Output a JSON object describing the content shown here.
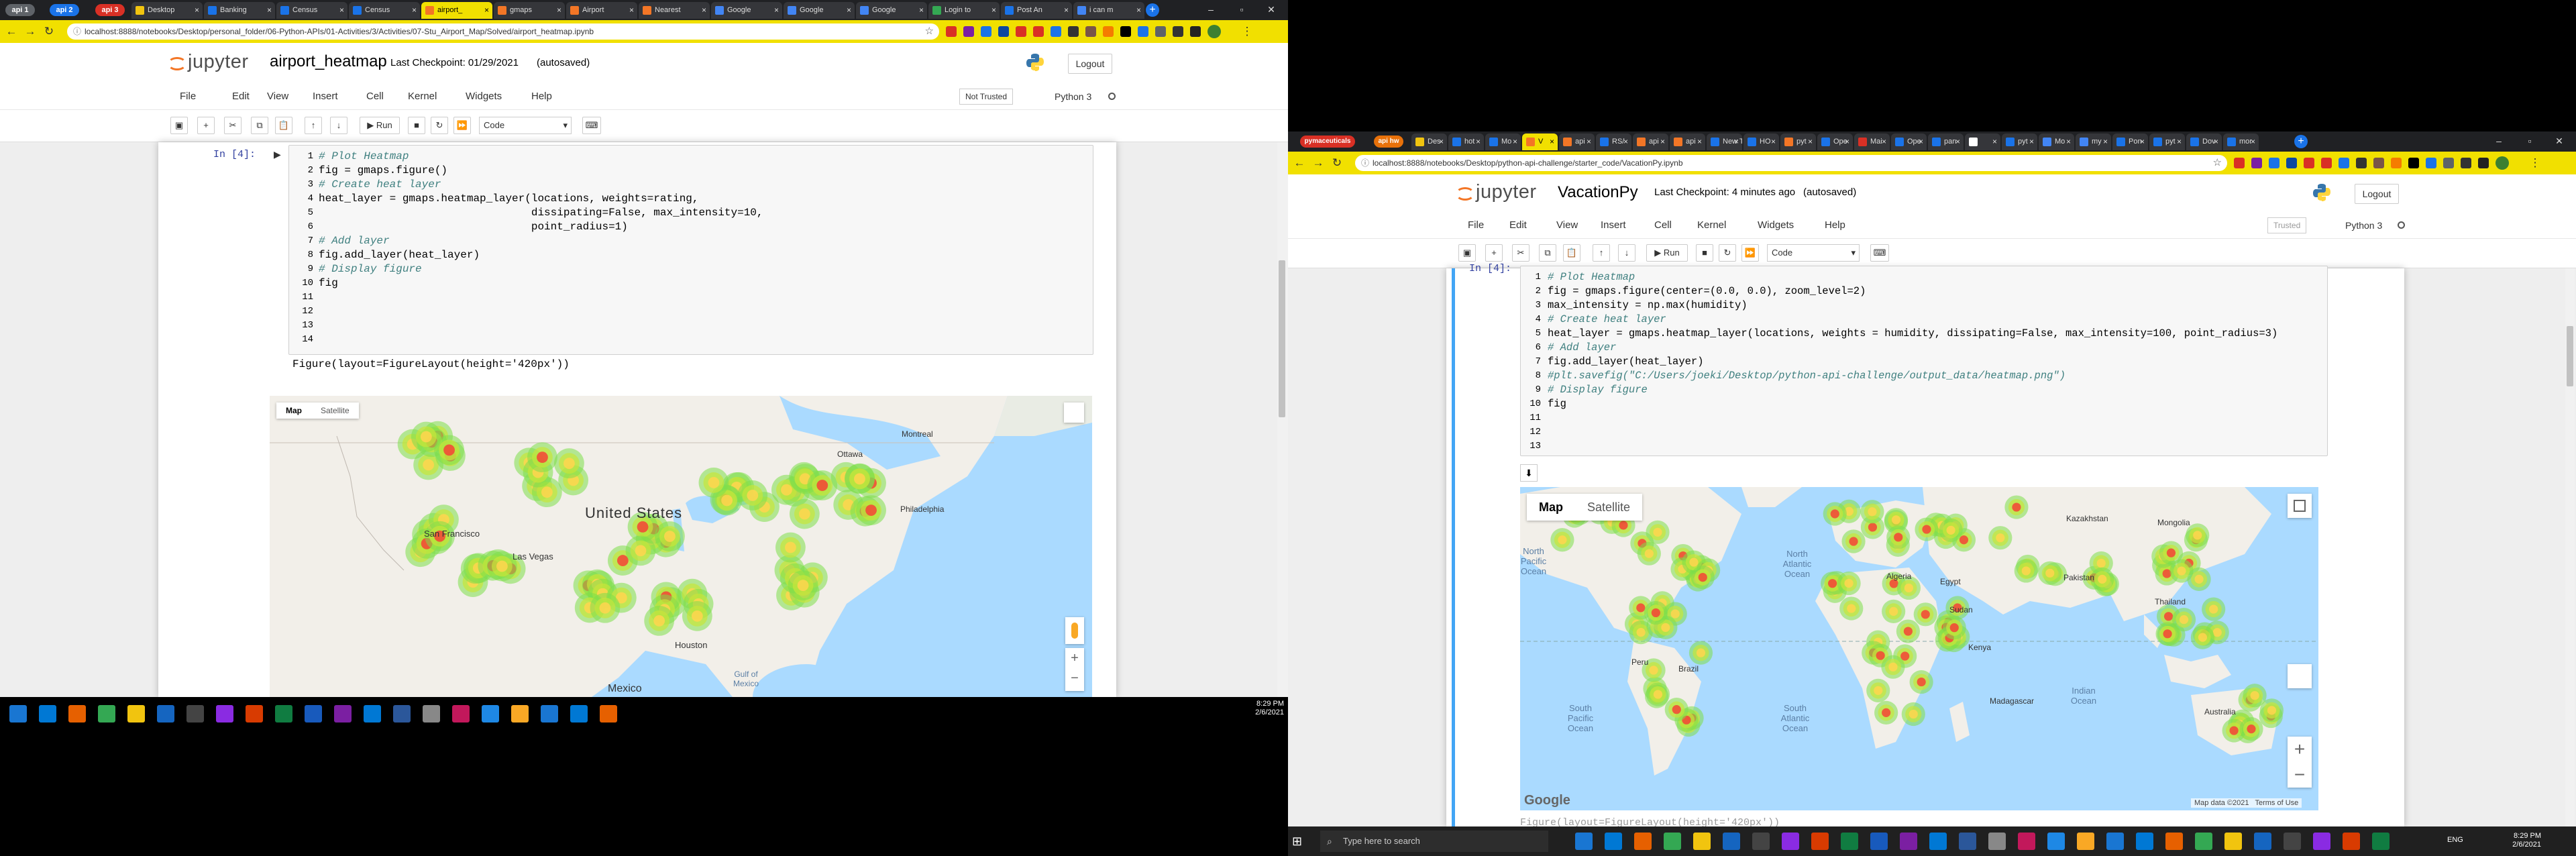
{
  "left_window": {
    "tab_groups": [
      {
        "label": "api 1",
        "color": "#5f6368"
      },
      {
        "label": "api 2",
        "color": "#1a73e8"
      },
      {
        "label": "api 3",
        "color": "#d93025"
      }
    ],
    "tabs": [
      {
        "title": "Desktop",
        "favicon_color": "#f1c40f"
      },
      {
        "title": "Banking",
        "favicon_color": "#1a73e8"
      },
      {
        "title": "Census",
        "favicon_color": "#1a73e8"
      },
      {
        "title": "Census",
        "favicon_color": "#1a73e8"
      },
      {
        "title": "airport_",
        "favicon_color": "#f37626",
        "active": true
      },
      {
        "title": "gmaps",
        "favicon_color": "#f37626"
      },
      {
        "title": "Airport",
        "favicon_color": "#f37626"
      },
      {
        "title": "Nearest",
        "favicon_color": "#f37626"
      },
      {
        "title": "Google",
        "favicon_color": "#4285f4"
      },
      {
        "title": "Google",
        "favicon_color": "#4285f4"
      },
      {
        "title": "Google",
        "favicon_color": "#4285f4"
      },
      {
        "title": "Login to",
        "favicon_color": "#34a853"
      },
      {
        "title": "Post An",
        "favicon_color": "#1a73e8"
      },
      {
        "title": "i can m",
        "favicon_color": "#4285f4"
      }
    ],
    "url": "localhost:8888/notebooks/Desktop/personal_folder/06-Python-APIs/01-Activities/3/Activities/07-Stu_Airport_Map/Solved/airport_heatmap.ipynb",
    "notebook_name": "airport_heatmap",
    "checkpoint": "Last Checkpoint: 01/29/2021",
    "autosave": "(autosaved)",
    "logout": "Logout",
    "menu": [
      "File",
      "Edit",
      "View",
      "Insert",
      "Cell",
      "Kernel",
      "Widgets",
      "Help"
    ],
    "trust": "Not Trusted",
    "kernel": "Python 3",
    "run_label": "Run",
    "cell_type": "Code",
    "cell_prompt": "In [4]:",
    "code_lines": [
      "# Plot Heatmap",
      "fig = gmaps.figure()",
      "",
      "# Create heat layer",
      "heat_layer = gmaps.heatmap_layer(locations, weights=rating,",
      "                                 dissipating=False, max_intensity=10,",
      "                                 point_radius=1)",
      "",
      "",
      "# Add layer",
      "fig.add_layer(heat_layer)",
      "",
      "# Display figure",
      "fig"
    ],
    "output_text": "Figure(layout=FigureLayout(height='420px'))",
    "map": {
      "type_map": "Map",
      "type_satellite": "Satellite",
      "labels": [
        "United States",
        "Ottawa",
        "Montreal",
        "Philadelphia",
        "San Francisco",
        "Las Vegas",
        "Houston",
        "Mexico",
        "Gulf of Mexico"
      ]
    }
  },
  "right_window": {
    "tab_groups": [
      {
        "label": "pymaceuticals",
        "color": "#d93025"
      },
      {
        "label": "api hw",
        "color": "#e8710a"
      }
    ],
    "tabs": [
      {
        "title": "Des",
        "favicon_color": "#f1c40f"
      },
      {
        "title": "hot",
        "favicon_color": "#1a73e8"
      },
      {
        "title": "Mo",
        "favicon_color": "#1a73e8"
      },
      {
        "title": "V",
        "favicon_color": "#f37626",
        "active": true
      },
      {
        "title": "api",
        "favicon_color": "#f37626"
      },
      {
        "title": "RS/",
        "favicon_color": "#1a73e8"
      },
      {
        "title": "api",
        "favicon_color": "#f37626"
      },
      {
        "title": "api",
        "favicon_color": "#f37626"
      },
      {
        "title": "New Tab",
        "favicon_color": "#1a73e8"
      },
      {
        "title": "HO",
        "favicon_color": "#1a73e8"
      },
      {
        "title": "pyt",
        "favicon_color": "#f37626"
      },
      {
        "title": "Ope",
        "favicon_color": "#1a73e8"
      },
      {
        "title": "Mai",
        "favicon_color": "#d93025"
      },
      {
        "title": "Ope",
        "favicon_color": "#1a73e8"
      },
      {
        "title": "pan",
        "favicon_color": "#1a73e8"
      },
      {
        "title": "",
        "favicon_color": "#ffffff"
      },
      {
        "title": "pyt",
        "favicon_color": "#1a73e8"
      },
      {
        "title": "Mo",
        "favicon_color": "#4285f4"
      },
      {
        "title": "my",
        "favicon_color": "#4285f4"
      },
      {
        "title": "Pon",
        "favicon_color": "#1a73e8"
      },
      {
        "title": "pyt",
        "favicon_color": "#1a73e8"
      },
      {
        "title": "Dov",
        "favicon_color": "#1a73e8"
      },
      {
        "title": "mor",
        "favicon_color": "#1a73e8"
      }
    ],
    "url": "localhost:8888/notebooks/Desktop/python-api-challenge/starter_code/VacationPy.ipynb",
    "notebook_name": "VacationPy",
    "checkpoint": "Last Checkpoint: 4 minutes ago",
    "autosave": "(autosaved)",
    "logout": "Logout",
    "menu": [
      "File",
      "Edit",
      "View",
      "Insert",
      "Cell",
      "Kernel",
      "Widgets",
      "Help"
    ],
    "trust": "Trusted",
    "kernel": "Python 3",
    "run_label": "Run",
    "cell_type": "Code",
    "cell_prompt": "In [4]:",
    "code_lines": [
      "# Plot Heatmap",
      "fig = gmaps.figure(center=(0.0, 0.0), zoom_level=2)",
      "max_intensity = np.max(humidity)",
      "",
      "# Create heat layer",
      "heat_layer = gmaps.heatmap_layer(locations, weights = humidity, dissipating=False, max_intensity=100, point_radius=3)",
      "",
      "# Add layer",
      "fig.add_layer(heat_layer)",
      "#plt.savefig(\"C:/Users/joeki/Desktop/python-api-challenge/output_data/heatmap.png\")",
      "",
      "# Display figure",
      "fig"
    ],
    "map": {
      "type_map": "Map",
      "type_satellite": "Satellite",
      "labels": [
        "North Atlantic Ocean",
        "North Pacific Ocean",
        "South Pacific Ocean",
        "South Atlantic Ocean",
        "Indian Ocean",
        "Algeria",
        "Kenya",
        "Madagascar",
        "Australia",
        "Mongolia",
        "Kazakhstan",
        "Pakistan",
        "Thailand",
        "Brazil",
        "Peru",
        "Egypt",
        "Sudan"
      ],
      "google": "Google",
      "data_credit": "Map data ©2021",
      "terms": "Terms of Use"
    },
    "next_line": "Figure(layout=FigureLayout(height='420px'))"
  },
  "taskbar_left": {
    "time": "8:29 PM",
    "date": "2/6/2021"
  },
  "taskbar_right": {
    "search_placeholder": "Type here to search",
    "lang": "ENG",
    "time": "8:29 PM",
    "date": "2/6/2021"
  }
}
